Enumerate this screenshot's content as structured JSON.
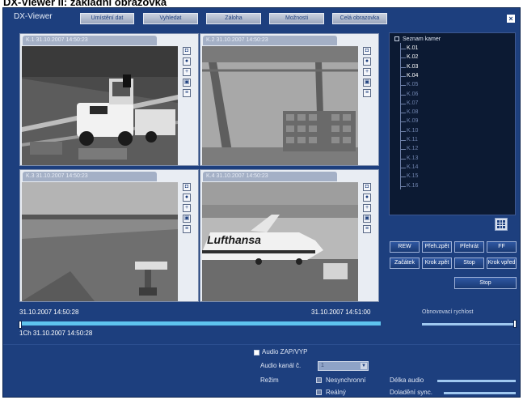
{
  "caption": "DX-Viewer II: základní obrazovka",
  "app": {
    "title": "DX-Viewer",
    "menu": [
      "Umístění dat",
      "Vyhledat",
      "Záloha",
      "Možnosti",
      "Celá obrazovka"
    ],
    "close_symbol": "×"
  },
  "cameras": [
    {
      "tab": "K.1 31.10.2007 14:50:23"
    },
    {
      "tab": "K.2 31.10.2007 14:50:23"
    },
    {
      "tab": "K.3 31.10.2007 14:50:23"
    },
    {
      "tab": "K.4 31.10.2007 14:50:23"
    }
  ],
  "camera_tools": [
    "camera-icon",
    "record-icon",
    "zoom-icon",
    "snapshot-icon",
    "settings-icon"
  ],
  "overlay": {
    "airline": "Lufthansa"
  },
  "camera_list": {
    "header": "Seznam kamer",
    "items": [
      {
        "label": "K.01",
        "active": true
      },
      {
        "label": "K.02",
        "active": true
      },
      {
        "label": "K.03",
        "active": true
      },
      {
        "label": "K.04",
        "active": true
      },
      {
        "label": "K.05",
        "active": false
      },
      {
        "label": "K.06",
        "active": false
      },
      {
        "label": "K.07",
        "active": false
      },
      {
        "label": "K.08",
        "active": false
      },
      {
        "label": "K.09",
        "active": false
      },
      {
        "label": "K.10",
        "active": false
      },
      {
        "label": "K.11",
        "active": false
      },
      {
        "label": "K.12",
        "active": false
      },
      {
        "label": "K.13",
        "active": false
      },
      {
        "label": "K.14",
        "active": false
      },
      {
        "label": "K.15",
        "active": false
      },
      {
        "label": "K.16",
        "active": false
      }
    ],
    "layout_icon": "grid-layout-icon"
  },
  "controls": {
    "row1": [
      "REW",
      "Přeh.zpět",
      "Přehrát",
      "FF"
    ],
    "row2": [
      "Začátek",
      "Krok zpět",
      "Stop",
      "Krok vpřed"
    ],
    "stop": "Stop"
  },
  "timeline": {
    "start": "31.10.2007 14:50:28",
    "end": "31.10.2007 14:51:00",
    "current": "1Ch  31.10.2007 14:50:28",
    "position": 0.0,
    "refresh_label": "Obnovovací rychlost",
    "refresh_value": 1.0
  },
  "audio": {
    "toggle_label": "Audio ZAP/VYP",
    "channel_label": "Audio kanál č.",
    "channel_value": "1",
    "mode_label": "Režim",
    "mode_async": "Nesynchronní",
    "mode_real": "Reálný",
    "length_label": "Délka audio",
    "sync_label": "Doladění sync."
  }
}
